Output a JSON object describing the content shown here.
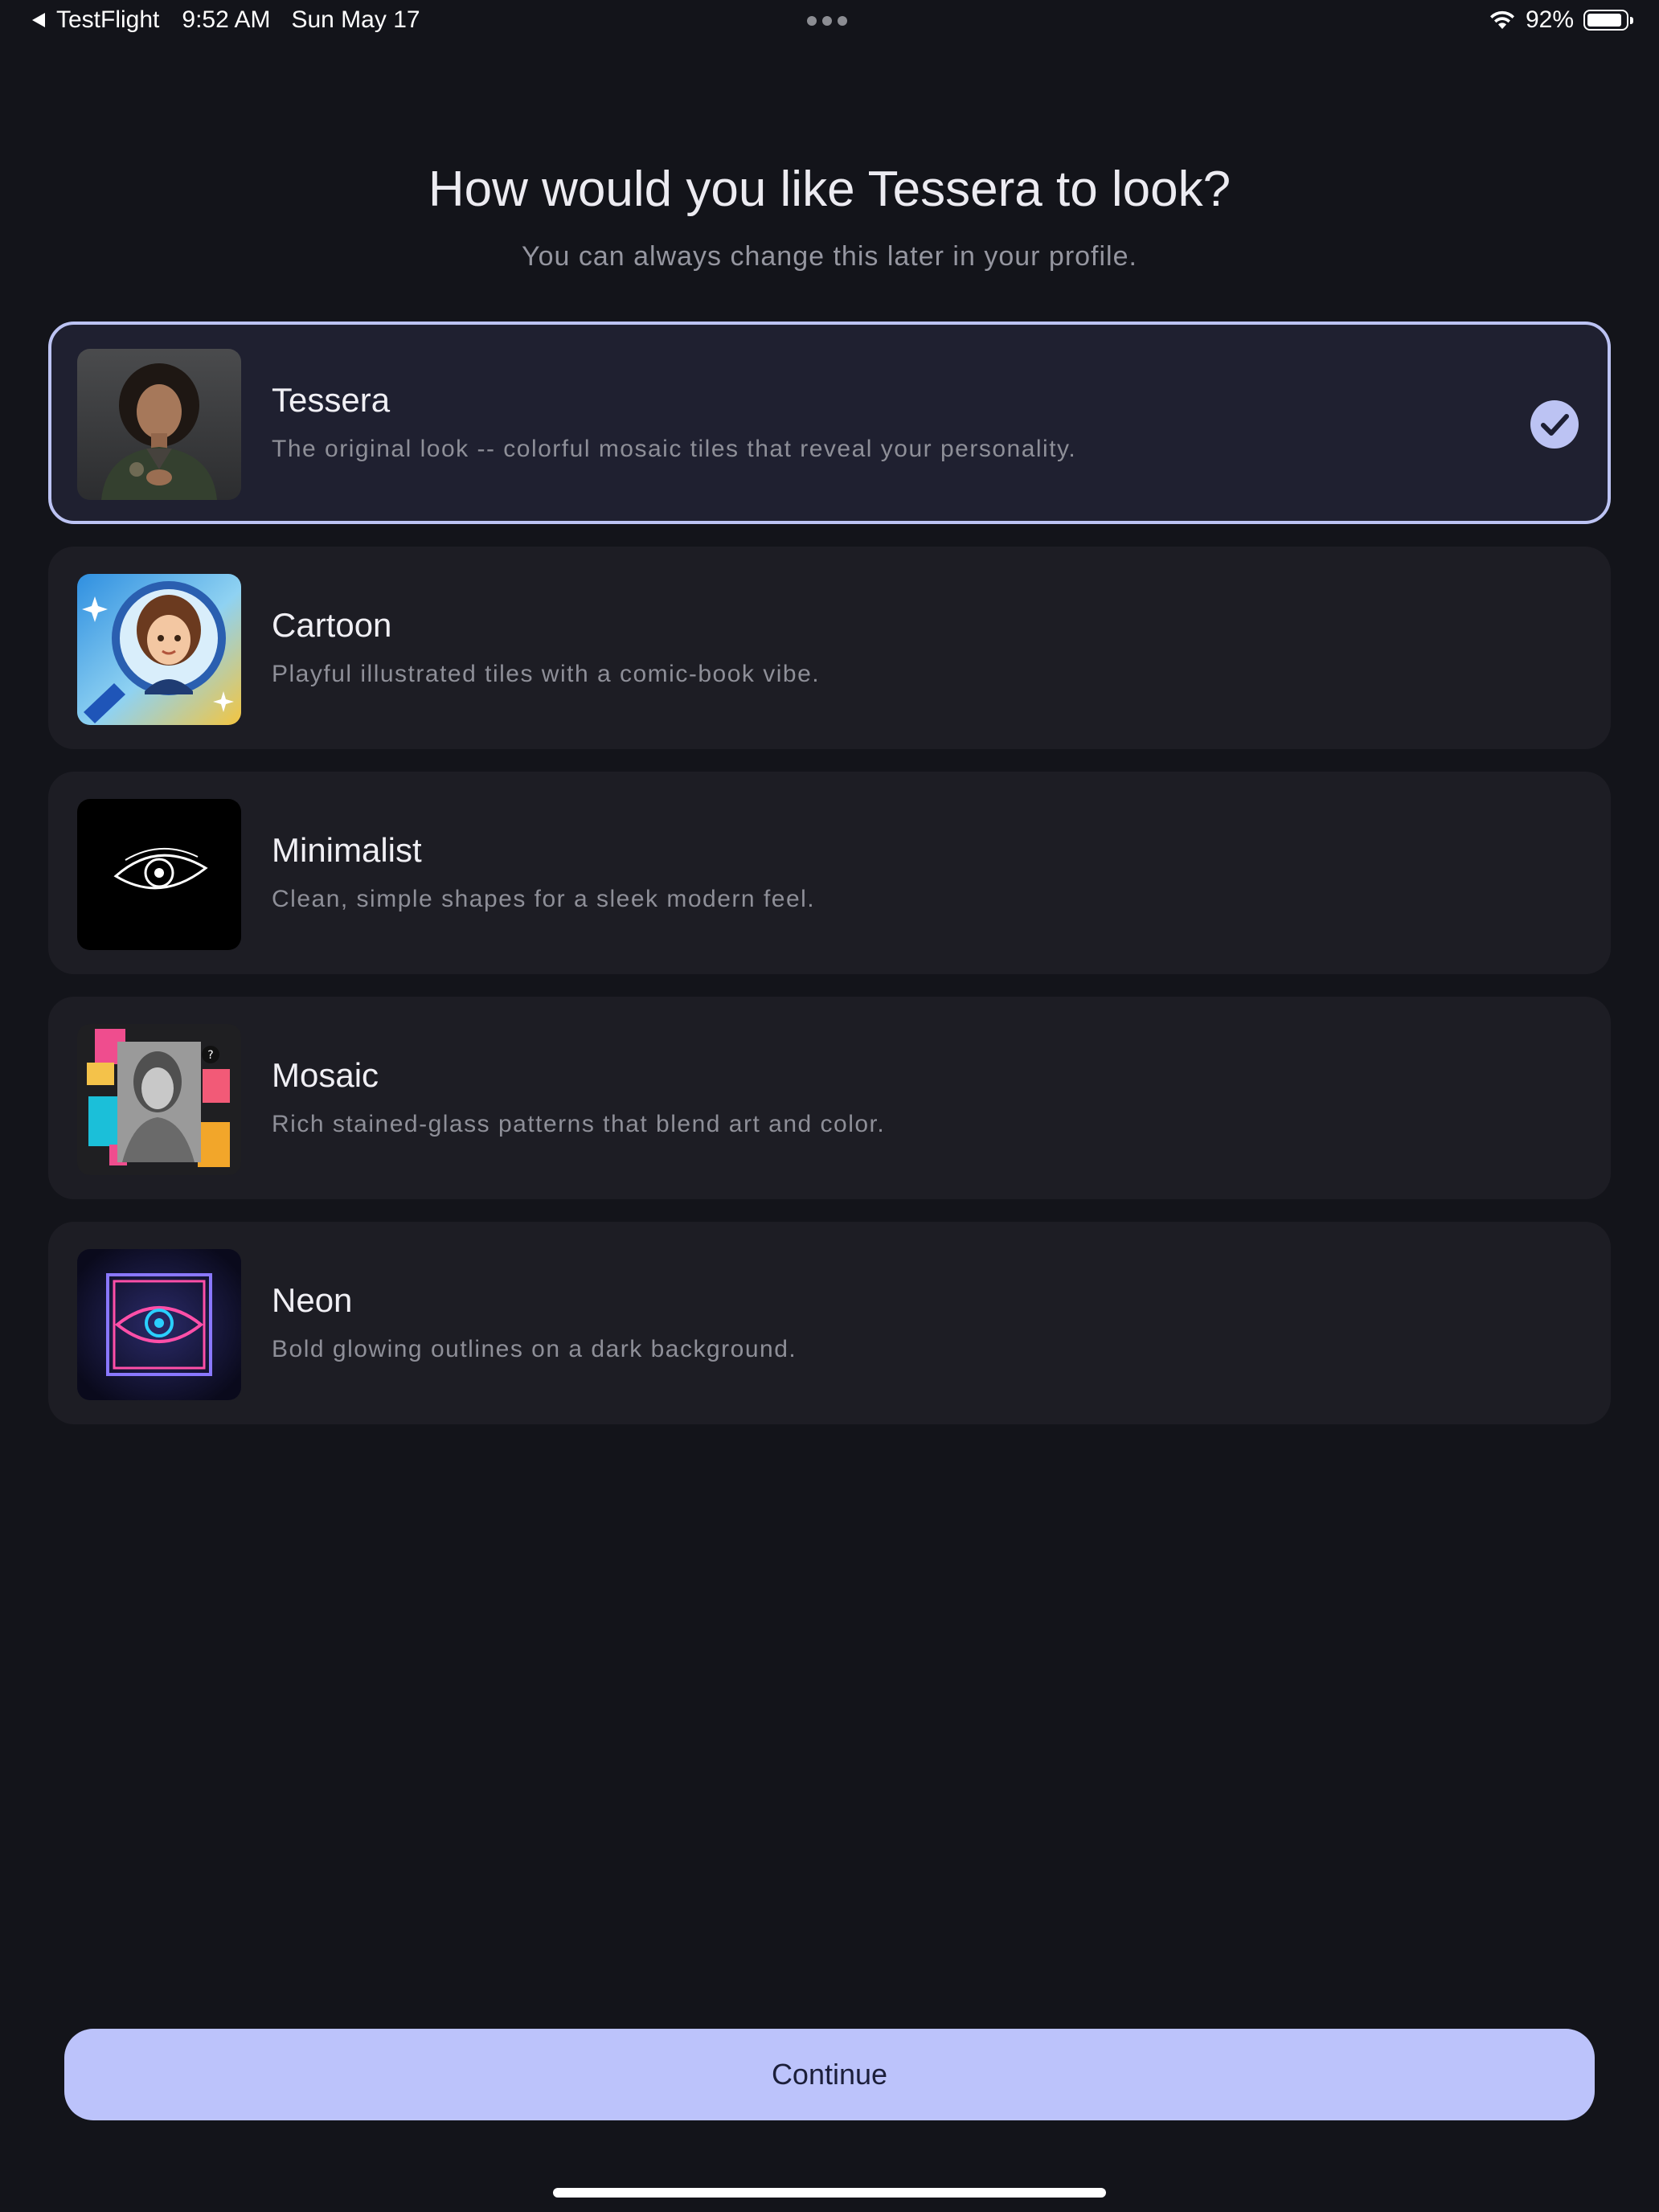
{
  "status_bar": {
    "back_app": "TestFlight",
    "time": "9:52 AM",
    "date": "Sun May 17",
    "battery_percent": "92%",
    "battery_level": 0.92
  },
  "header": {
    "title": "How would you like Tessera to look?",
    "subtitle": "You can always change this later in your profile."
  },
  "options": [
    {
      "name": "Tessera",
      "description": "The original look -- colorful mosaic tiles that reveal your personality.",
      "selected": true,
      "thumbnail": "portrait-photo"
    },
    {
      "name": "Cartoon",
      "description": "Playful illustrated tiles with a comic-book vibe.",
      "selected": false,
      "thumbnail": "cartoon-magnifier"
    },
    {
      "name": "Minimalist",
      "description": "Clean, simple shapes for a sleek modern feel.",
      "selected": false,
      "thumbnail": "line-eye"
    },
    {
      "name": "Mosaic",
      "description": "Rich stained-glass patterns that blend art and color.",
      "selected": false,
      "thumbnail": "mosaic-collage"
    },
    {
      "name": "Neon",
      "description": "Bold glowing outlines on a dark background.",
      "selected": false,
      "thumbnail": "neon-eye"
    }
  ],
  "continue_label": "Continue",
  "colors": {
    "background": "#13141a",
    "card": "#1d1d24",
    "accent": "#bcc3f3",
    "button": "#bcc3fb"
  }
}
